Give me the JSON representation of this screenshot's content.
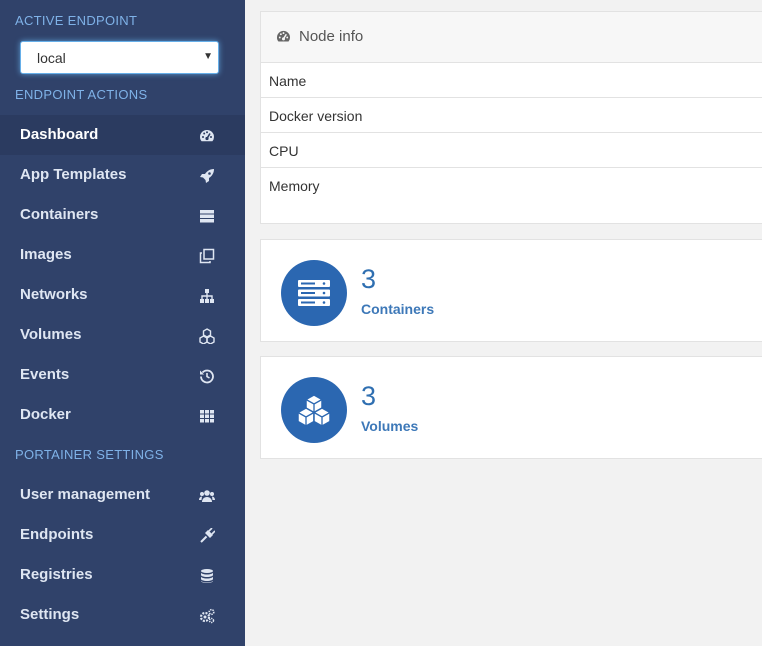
{
  "sidebar": {
    "active_endpoint_title": "ACTIVE ENDPOINT",
    "endpoint_value": "local",
    "endpoint_actions_title": "ENDPOINT ACTIONS",
    "portainer_settings_title": "PORTAINER SETTINGS",
    "actions": [
      {
        "label": "Dashboard",
        "icon": "tachometer-icon",
        "active": true
      },
      {
        "label": "App Templates",
        "icon": "rocket-icon"
      },
      {
        "label": "Containers",
        "icon": "server-icon"
      },
      {
        "label": "Images",
        "icon": "clone-icon"
      },
      {
        "label": "Networks",
        "icon": "sitemap-icon"
      },
      {
        "label": "Volumes",
        "icon": "cubes-icon"
      },
      {
        "label": "Events",
        "icon": "history-icon"
      },
      {
        "label": "Docker",
        "icon": "th-icon"
      }
    ],
    "settings": [
      {
        "label": "User management",
        "icon": "users-icon"
      },
      {
        "label": "Endpoints",
        "icon": "plug-icon"
      },
      {
        "label": "Registries",
        "icon": "database-icon"
      },
      {
        "label": "Settings",
        "icon": "cogs-icon"
      }
    ]
  },
  "node_info": {
    "title": "Node info",
    "rows": [
      "Name",
      "Docker version",
      "CPU",
      "Memory"
    ]
  },
  "stats": {
    "containers": {
      "count": "3",
      "label": "Containers"
    },
    "volumes": {
      "count": "3",
      "label": "Volumes"
    }
  },
  "colors": {
    "sidebar_bg": "#30426a",
    "section_title": "#7fb2e8",
    "accent": "#2b67b1"
  }
}
